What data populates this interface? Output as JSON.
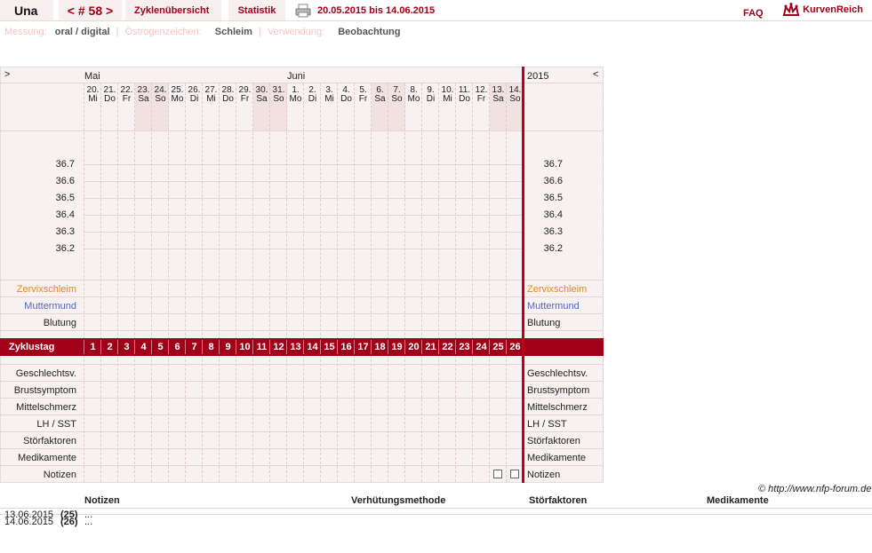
{
  "header": {
    "user": "Una",
    "cycle_nav": "< # 58 >",
    "tab_overview": "Zyklenübersicht",
    "tab_statistics": "Statistik",
    "date_range": "20.05.2015 bis 14.06.2015",
    "faq": "FAQ",
    "brand": "KurvenReich"
  },
  "settings": {
    "measure_label": "Messung:",
    "measure_value": "oral / digital",
    "estrogen_label": "Östrogenzeichen:",
    "estrogen_value": "Schleim",
    "use_label": "Verwendung:",
    "use_value": "Beobachtung"
  },
  "chart": {
    "nav_prev": ">",
    "nav_next": "<",
    "month_may": "Mai",
    "month_june": "Juni",
    "year": "2015",
    "days": [
      {
        "d": "20.",
        "w": "Mi",
        "we": false
      },
      {
        "d": "21.",
        "w": "Do",
        "we": false
      },
      {
        "d": "22.",
        "w": "Fr",
        "we": false
      },
      {
        "d": "23.",
        "w": "Sa",
        "we": true
      },
      {
        "d": "24.",
        "w": "So",
        "we": true
      },
      {
        "d": "25.",
        "w": "Mo",
        "we": false
      },
      {
        "d": "26.",
        "w": "Di",
        "we": false
      },
      {
        "d": "27.",
        "w": "Mi",
        "we": false
      },
      {
        "d": "28.",
        "w": "Do",
        "we": false
      },
      {
        "d": "29.",
        "w": "Fr",
        "we": false
      },
      {
        "d": "30.",
        "w": "Sa",
        "we": true
      },
      {
        "d": "31.",
        "w": "So",
        "we": true
      },
      {
        "d": "1.",
        "w": "Mo",
        "we": false
      },
      {
        "d": "2.",
        "w": "Di",
        "we": false
      },
      {
        "d": "3.",
        "w": "Mi",
        "we": false
      },
      {
        "d": "4.",
        "w": "Do",
        "we": false
      },
      {
        "d": "5.",
        "w": "Fr",
        "we": false
      },
      {
        "d": "6.",
        "w": "Sa",
        "we": true
      },
      {
        "d": "7.",
        "w": "So",
        "we": true
      },
      {
        "d": "8.",
        "w": "Mo",
        "we": false
      },
      {
        "d": "9.",
        "w": "Di",
        "we": false
      },
      {
        "d": "10.",
        "w": "Mi",
        "we": false
      },
      {
        "d": "11.",
        "w": "Do",
        "we": false
      },
      {
        "d": "12.",
        "w": "Fr",
        "we": false
      },
      {
        "d": "13.",
        "w": "Sa",
        "we": true
      },
      {
        "d": "14.",
        "w": "So",
        "we": true
      }
    ],
    "temperatures": [
      "36.7",
      "36.6",
      "36.5",
      "36.4",
      "36.3",
      "36.2"
    ],
    "rows_top": [
      {
        "label": "Zervixschleim",
        "color": "orange"
      },
      {
        "label": "Muttermund",
        "color": "blue"
      },
      {
        "label": "Blutung",
        "color": "dark"
      }
    ],
    "cycle_day_label": "Zyklustag",
    "cycle_days": [
      "1",
      "2",
      "3",
      "4",
      "5",
      "6",
      "7",
      "8",
      "9",
      "10",
      "11",
      "12",
      "13",
      "14",
      "15",
      "16",
      "17",
      "18",
      "19",
      "20",
      "21",
      "22",
      "23",
      "24",
      "25",
      "26"
    ],
    "rows_bottom": [
      "Geschlechtsv.",
      "Brustsymptom",
      "Mittelschmerz",
      "LH / SST",
      "Störfaktoren",
      "Medikamente",
      "Notizen"
    ],
    "notes_icons_on_days": [
      25,
      26
    ]
  },
  "footer": {
    "copyright": "© http://www.nfp-forum.de",
    "col_notes": "Notizen",
    "col_contraception": "Verhütungsmethode",
    "col_disturbances": "Störfaktoren",
    "col_medication": "Medikamente",
    "entries": [
      {
        "date": "13.06.2015",
        "day": "(25)",
        "note": "..."
      },
      {
        "date": "14.06.2015",
        "day": "(26)",
        "note": "..."
      }
    ]
  },
  "colors": {
    "accent": "#a00018",
    "today_line": "#c00010",
    "panel": "#f8f1f1"
  }
}
